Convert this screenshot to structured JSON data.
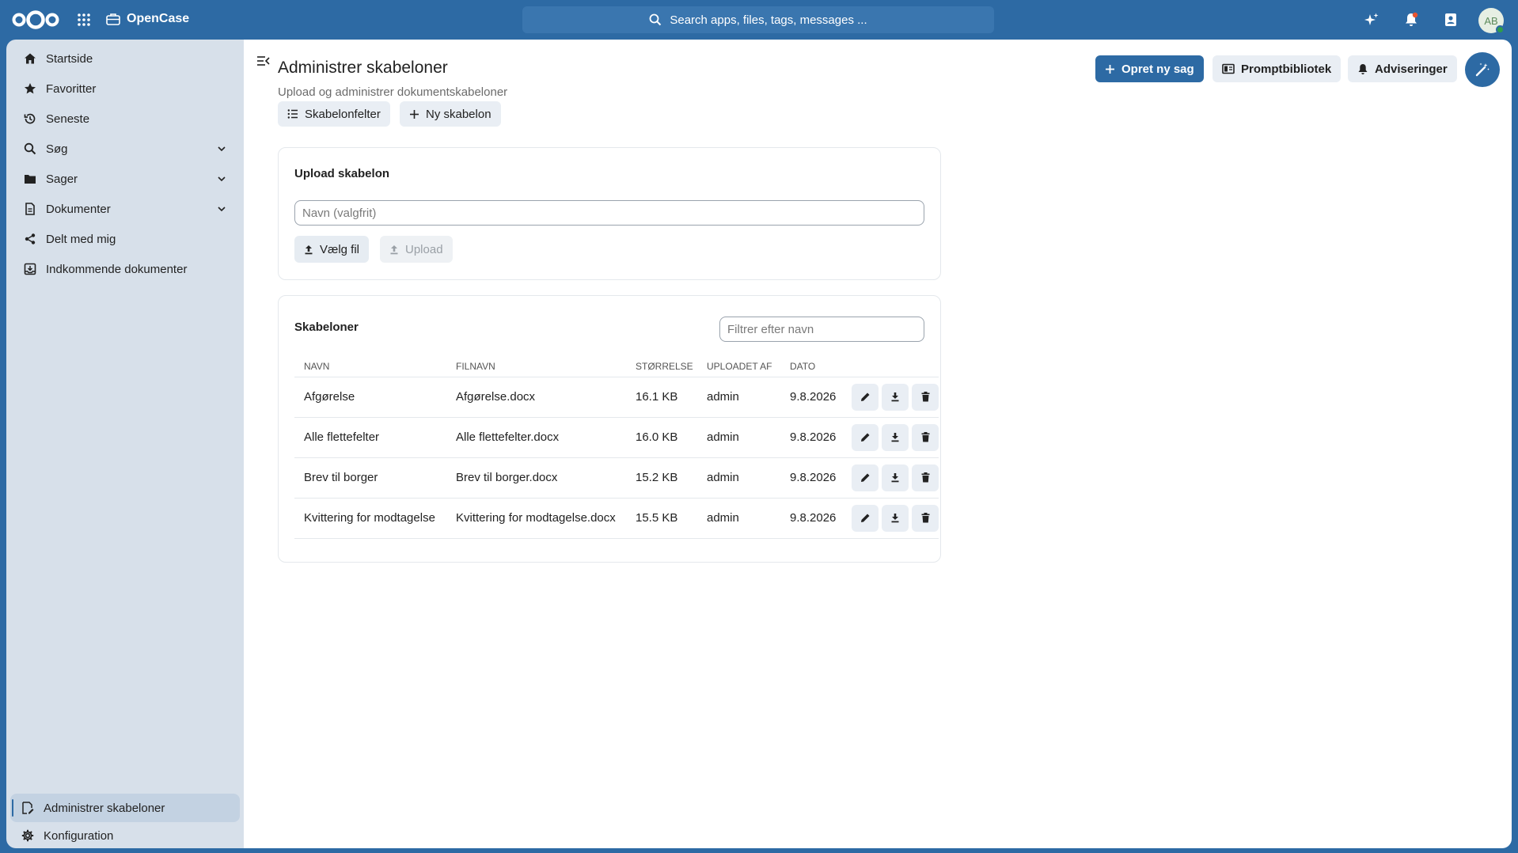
{
  "app": {
    "name": "OpenCase",
    "search_placeholder": "Search apps, files, tags, messages ...",
    "user_initials": "AB"
  },
  "colors": {
    "brand": "#2d6aa4",
    "sidebar": "#d7e0ea",
    "status_online": "#2e9d4a"
  },
  "sidebar": {
    "items": [
      {
        "label": "Startside",
        "icon": "home-icon"
      },
      {
        "label": "Favoritter",
        "icon": "star-icon"
      },
      {
        "label": "Seneste",
        "icon": "history-icon"
      },
      {
        "label": "Søg",
        "icon": "search-icon",
        "expandable": true
      },
      {
        "label": "Sager",
        "icon": "folder-icon",
        "expandable": true
      },
      {
        "label": "Dokumenter",
        "icon": "document-icon",
        "expandable": true
      },
      {
        "label": "Delt med mig",
        "icon": "share-icon"
      },
      {
        "label": "Indkommende dokumenter",
        "icon": "inbox-icon"
      }
    ],
    "footer": [
      {
        "label": "Administrer skabeloner",
        "icon": "template-icon",
        "active": true
      },
      {
        "label": "Konfiguration",
        "icon": "gear-icon"
      }
    ]
  },
  "header": {
    "title": "Administrer skabeloner",
    "subtitle": "Upload og administrer dokumentskabeloner",
    "buttons": {
      "new_case": "Opret ny sag",
      "prompt_library": "Promptbibliotek",
      "notifications": "Adviseringer"
    },
    "tabs": {
      "fields": "Skabelonfelter",
      "new_template": "Ny skabelon"
    }
  },
  "upload": {
    "title": "Upload skabelon",
    "name_placeholder": "Navn (valgfrit)",
    "choose_file": "Vælg fil",
    "upload": "Upload"
  },
  "templates": {
    "title": "Skabeloner",
    "filter_placeholder": "Filtrer efter navn",
    "columns": [
      "Navn",
      "Filnavn",
      "Størrelse",
      "Uploadet af",
      "Dato"
    ],
    "rows": [
      {
        "name": "Afgørelse",
        "file": "Afgørelse.docx",
        "size": "16.1 KB",
        "by": "admin",
        "date": "9.8.2026"
      },
      {
        "name": "Alle flettefelter",
        "file": "Alle flettefelter.docx",
        "size": "16.0 KB",
        "by": "admin",
        "date": "9.8.2026"
      },
      {
        "name": "Brev til borger",
        "file": "Brev til borger.docx",
        "size": "15.2 KB",
        "by": "admin",
        "date": "9.8.2026"
      },
      {
        "name": "Kvittering for modtagelse",
        "file": "Kvittering for modtagelse.docx",
        "size": "15.5 KB",
        "by": "admin",
        "date": "9.8.2026"
      }
    ]
  }
}
